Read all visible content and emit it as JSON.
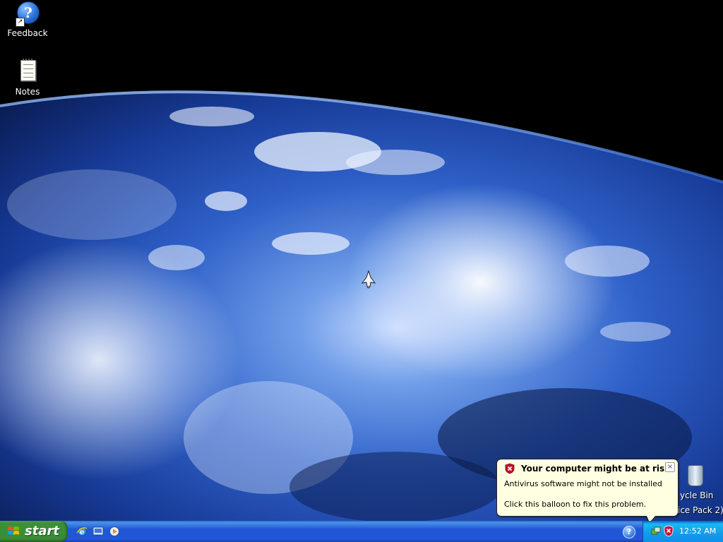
{
  "desktop": {
    "icons": [
      {
        "label": "Feedback",
        "icon": "help-icon"
      },
      {
        "label": "Notes",
        "icon": "notepad-icon"
      }
    ],
    "recycle_bin": {
      "label": "ycle Bin",
      "extra": "ice Pack 2)"
    }
  },
  "balloon": {
    "title": "Your computer might be at risk",
    "line1": "Antivirus software might not be installed",
    "line2": "Click this balloon to fix this problem.",
    "close": "×"
  },
  "taskbar": {
    "start_label": "start",
    "quick_launch": [
      "internet-explorer-icon",
      "show-desktop-icon",
      "media-player-icon"
    ],
    "tray": {
      "help": "?",
      "clock": "12:52 AM",
      "icons": [
        "network-icon",
        "security-center-shield-icon"
      ]
    }
  },
  "colors": {
    "taskbar_blue": "#2157d7",
    "start_green": "#379136",
    "tray_blue": "#139beb",
    "balloon_bg": "#ffffe1",
    "shield_red": "#c8102e"
  }
}
